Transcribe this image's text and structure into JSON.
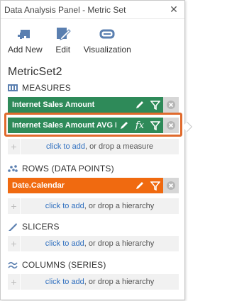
{
  "window": {
    "title": "Data Analysis Panel - Metric Set",
    "close_icon": "close-icon"
  },
  "toolbar": {
    "add_new": "Add New",
    "edit": "Edit",
    "visualization": "Visualization"
  },
  "metric_set": {
    "name": "MetricSet2"
  },
  "measures": {
    "heading": "MEASURES",
    "items": [
      {
        "label": "Internet Sales Amount"
      },
      {
        "label": "Internet Sales Amount AVG E...",
        "fx": "fx"
      }
    ],
    "drop_link": "click to add",
    "drop_rest": ", or drop a measure"
  },
  "rows": {
    "heading": "ROWS (DATA POINTS)",
    "items": [
      {
        "label": "Date.Calendar"
      }
    ],
    "drop_link": "click to add",
    "drop_rest": ", or drop a hierarchy"
  },
  "slicers": {
    "heading": "SLICERS",
    "drop_link": "click to add",
    "drop_rest": ", or drop a hierarchy"
  },
  "columns": {
    "heading": "COLUMNS (SERIES)",
    "drop_link": "click to add",
    "drop_rest": ", or drop a hierarchy"
  },
  "colors": {
    "measure": "#2e8a59",
    "hierarchy": "#f06a10",
    "highlight": "#e06a2c",
    "link": "#2f6fbf"
  }
}
